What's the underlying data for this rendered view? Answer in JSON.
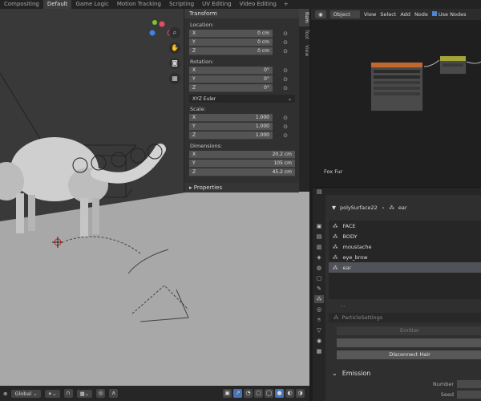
{
  "workspace_tabs": [
    "Compositing",
    "Default",
    "Game Logic",
    "Motion Tracking",
    "Scripting",
    "UV Editing",
    "Video Editing"
  ],
  "active_workspace": "Default",
  "add_tab": "+",
  "transform": {
    "header": "Transform",
    "location_label": "Location:",
    "location": [
      {
        "axis": "X",
        "value": "0 cm"
      },
      {
        "axis": "Y",
        "value": "0 cm"
      },
      {
        "axis": "Z",
        "value": "0 cm"
      }
    ],
    "rotation_label": "Rotation:",
    "rotation": [
      {
        "axis": "X",
        "value": "0°"
      },
      {
        "axis": "Y",
        "value": "0°"
      },
      {
        "axis": "Z",
        "value": "0°"
      }
    ],
    "rotation_mode": "XYZ Euler",
    "scale_label": "Scale:",
    "scale": [
      {
        "axis": "X",
        "value": "1.000"
      },
      {
        "axis": "Y",
        "value": "1.000"
      },
      {
        "axis": "Z",
        "value": "1.000"
      }
    ],
    "dimensions_label": "Dimensions:",
    "dimensions": [
      {
        "axis": "X",
        "value": "20.2 cm"
      },
      {
        "axis": "Y",
        "value": "105 cm"
      },
      {
        "axis": "Z",
        "value": "45.2 cm"
      }
    ],
    "properties_header": "Properties"
  },
  "side_tabs": [
    "Item",
    "Tool",
    "View"
  ],
  "node_editor": {
    "mode": "Object",
    "menus": [
      "View",
      "Select",
      "Add",
      "Node"
    ],
    "use_nodes_label": "Use Nodes",
    "material_label": "Fox Fur"
  },
  "properties_panel": {
    "object_name": "polySurface22",
    "particle_name": "ear",
    "particle_systems": [
      "FACE",
      "BODY",
      "moustache",
      "eye_brow",
      "ear"
    ],
    "selected_system": "ear",
    "settings_placeholder": "ParticleSettings",
    "emitter_label": "Emitter",
    "disconnect_label": "Disconnect Hair",
    "emission_header": "Emission",
    "number_label": "Number",
    "seed_label": "Seed"
  },
  "bottom_bar": {
    "orientation": "Global"
  },
  "colors": {
    "accent": "#4772b3",
    "selected_row": "#4f5258",
    "particle_node_header": "#c0682e",
    "texture_node_header": "#a4a438",
    "gizmo_x": "#e84c62",
    "gizmo_y": "#7fc430",
    "gizmo_z": "#3f82e0"
  }
}
